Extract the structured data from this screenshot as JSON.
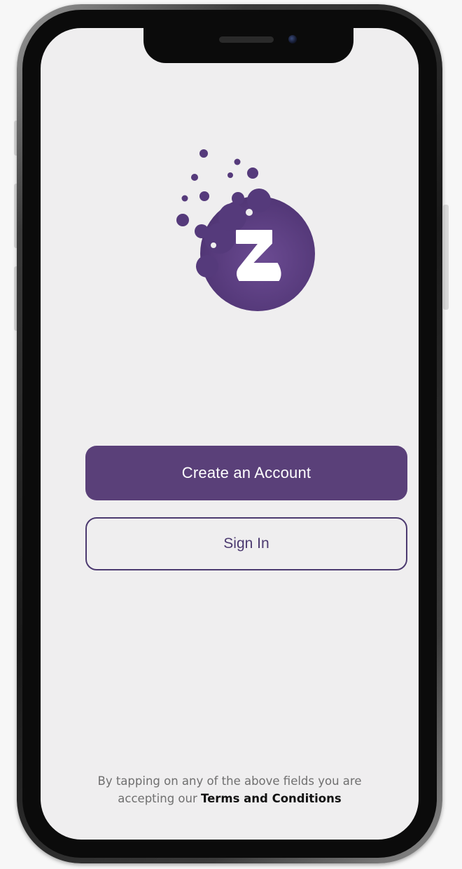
{
  "app": {
    "logo_icon": "z-bubble-logo",
    "brand_color": "#5a4079"
  },
  "actions": {
    "create_account_label": "Create an Account",
    "sign_in_label": "Sign In"
  },
  "footer": {
    "line1": "By tapping on any of the above fields you are",
    "line2_prefix": "accepting our",
    "terms_link": "Terms and Conditions"
  }
}
